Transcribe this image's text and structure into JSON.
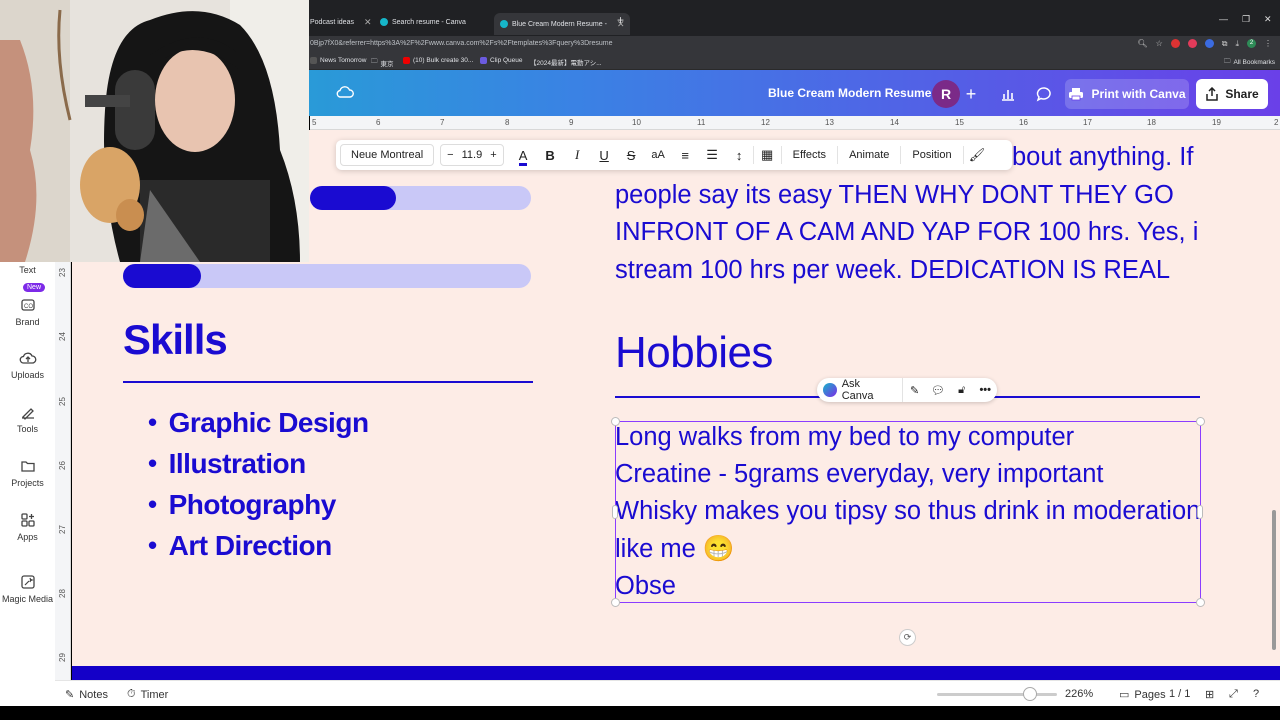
{
  "browser": {
    "tabs": [
      {
        "label": "Podcast ideas"
      },
      {
        "label": "Search resume - Canva"
      },
      {
        "label": "Blue Cream Modern Resume - "
      }
    ],
    "url": "0Bjp7fX0&referrer=https%3A%2F%2Fwww.canva.com%2Fs%2Ftemplates%3Fquery%3Dresume",
    "bookmarks": [
      "News Tomorrow",
      "東京",
      "(10) Bulk create 30...",
      "Clip Queue",
      "【2024最新】電動アシ..."
    ],
    "all_bookmarks": "All Bookmarks",
    "extension_badge": "2"
  },
  "canva": {
    "doc_title": "Blue Cream Modern Resume",
    "avatar_initial": "R",
    "print_label": "Print with Canva",
    "share_label": "Share",
    "ruler_marks": [
      "5",
      "6",
      "7",
      "8",
      "9",
      "10",
      "11",
      "12",
      "13",
      "14",
      "15",
      "16",
      "17",
      "18",
      "19",
      "2"
    ],
    "vruler_marks": [
      "23",
      "24",
      "25",
      "26",
      "27",
      "28",
      "29"
    ]
  },
  "sidebar": {
    "items": [
      {
        "label": "Text",
        "icon": "text-icon"
      },
      {
        "label": "Brand",
        "icon": "brand-icon",
        "badge": "New"
      },
      {
        "label": "Uploads",
        "icon": "upload-icon"
      },
      {
        "label": "Tools",
        "icon": "tools-icon"
      },
      {
        "label": "Projects",
        "icon": "folder-icon"
      },
      {
        "label": "Apps",
        "icon": "apps-icon"
      },
      {
        "label": "Magic Media",
        "icon": "magic-media-icon"
      }
    ]
  },
  "toolbar": {
    "font": "Neue Montreal",
    "size": "11.9",
    "effects": "Effects",
    "animate": "Animate",
    "position": "Position"
  },
  "resume": {
    "about_partial": "bout anything. If",
    "about_lines": [
      "people say its easy THEN WHY DONT THEY GO",
      "INFRONT OF A CAM AND YAP FOR 100 hrs. Yes, i",
      "stream 100 hrs per week. DEDICATION IS REAL"
    ],
    "skills_title": "Skills",
    "skills": [
      "Graphic Design",
      "Illustration",
      "Photography",
      "Art Direction"
    ],
    "skill_bars": [
      0.22,
      0.19
    ],
    "hobbies_title": "Hobbies",
    "hobbies_lines": [
      "Long walks from my bed to my computer",
      "Creatine - 5grams everyday, very important",
      "Whisky makes you tipsy so thus drink in moderation",
      "like me 😁",
      "Obse"
    ],
    "accent_color": "#1a0bd1"
  },
  "ask_canva": {
    "label": "Ask Canva"
  },
  "status": {
    "notes": "Notes",
    "timer": "Timer",
    "zoom": "226%",
    "pages": "Pages",
    "page_count": "1 / 1"
  }
}
